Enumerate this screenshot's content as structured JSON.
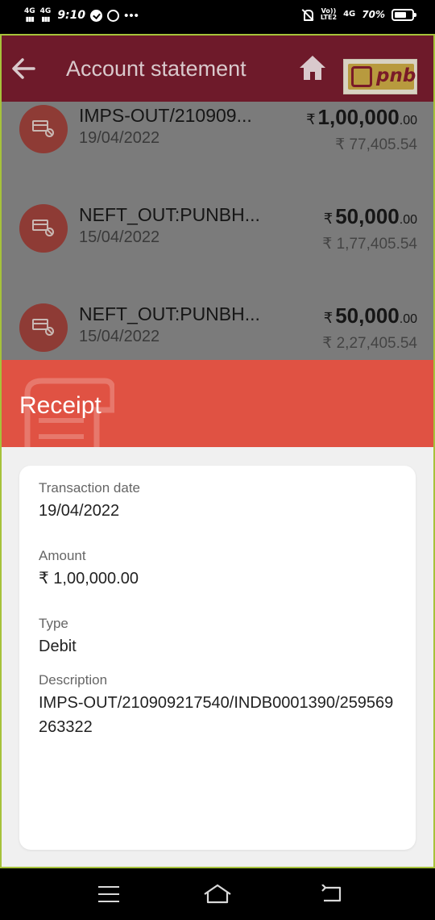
{
  "status_bar": {
    "net1": "4G",
    "net2": "4G",
    "time": "9:10",
    "dots": "•••",
    "volte_top": "Vo))",
    "volte_bottom": "LTE2",
    "net3": "4G",
    "battery_pct": "70%",
    "battery_level": 0.7
  },
  "app_bar": {
    "title": "Account statement",
    "logo_text": "pnb"
  },
  "transactions": [
    {
      "name": "IMPS-OUT/210909...",
      "date": "19/04/2022",
      "currency": "₹",
      "amount_main": "1,00,000",
      "amount_paise": ".00",
      "balance": "₹ 77,405.54"
    },
    {
      "name": "NEFT_OUT:PUNBH...",
      "date": "15/04/2022",
      "currency": "₹",
      "amount_main": "50,000",
      "amount_paise": ".00",
      "balance": "₹ 1,77,405.54"
    },
    {
      "name": "NEFT_OUT:PUNBH...",
      "date": "15/04/2022",
      "currency": "₹",
      "amount_main": "50,000",
      "amount_paise": ".00",
      "balance": "₹ 2,27,405.54"
    }
  ],
  "receipt": {
    "title": "Receipt",
    "fields": {
      "date_label": "Transaction date",
      "date_value": "19/04/2022",
      "amount_label": "Amount",
      "amount_value": "₹ 1,00,000.00",
      "type_label": "Type",
      "type_value": "Debit",
      "description_label": "Description",
      "description_value": "IMPS-OUT/210909217540/INDB0001390/259569263322"
    }
  },
  "colors": {
    "app_bar": "#6e1a2a",
    "receipt_header": "#e05243",
    "border": "#a6c23a"
  }
}
